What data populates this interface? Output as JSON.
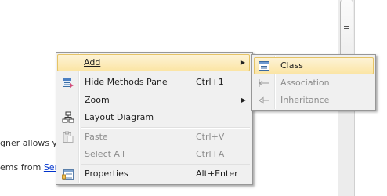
{
  "background": {
    "text1": "gner allows yo",
    "text2_prefix": "ems from ",
    "text2_link": "Serv"
  },
  "menu": {
    "add": {
      "label": "Add"
    },
    "hide_methods": {
      "label": "Hide Methods Pane",
      "shortcut": "Ctrl+1"
    },
    "zoom": {
      "label": "Zoom"
    },
    "layout": {
      "label": "Layout Diagram"
    },
    "paste": {
      "label": "Paste",
      "shortcut": "Ctrl+V"
    },
    "select_all": {
      "label": "Select All",
      "shortcut": "Ctrl+A"
    },
    "properties": {
      "label": "Properties",
      "shortcut": "Alt+Enter"
    }
  },
  "submenu": {
    "class": {
      "label": "Class"
    },
    "association": {
      "label": "Association"
    },
    "inheritance": {
      "label": "Inheritance"
    }
  },
  "icons": [
    "class-icon",
    "association-icon",
    "inheritance-icon",
    "hide-methods-icon",
    "layout-diagram-icon",
    "paste-icon",
    "properties-icon",
    "submenu-arrow-icon"
  ],
  "colors": {
    "highlight": "#fbe5a5",
    "highlight_border": "#e5c365",
    "menu_bg": "#f0f0f0",
    "disabled": "#8d8d8d",
    "link": "#0033cc"
  }
}
